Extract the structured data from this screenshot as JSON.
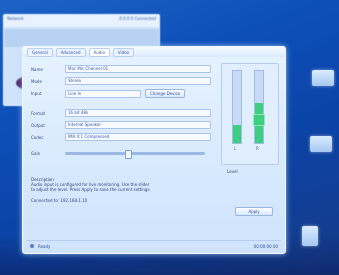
{
  "background_window": {
    "title": "Network",
    "subtitle": "0.0.0.0 Connected"
  },
  "dialog": {
    "tabs": [
      "General",
      "Advanced",
      "Audio",
      "Video"
    ],
    "active_tab": 2,
    "fields": [
      {
        "label": "Name",
        "value": "Mac Mic Channel 01"
      },
      {
        "label": "Mode",
        "value": "Stereo"
      },
      {
        "label": "Input",
        "value": "Line In",
        "button": "Change Device"
      },
      {
        "label": "Format",
        "value": "16 bit 48k"
      },
      {
        "label": "Output",
        "value": "Internal Speaker"
      },
      {
        "label": "Codec",
        "value": "IMA 4:1 Compressed"
      }
    ],
    "slider_label": "Gain",
    "info_caption": "Description",
    "info_lines": [
      "Audio input is configured for live monitoring. Use the slider",
      "to adjust the level. Press Apply to save the current settings.",
      "Connected to: 192.168.1.10"
    ],
    "meter_labels": [
      "L",
      "R"
    ],
    "meter_levels": [
      0.25,
      0.55
    ],
    "level_caption": "Level",
    "apply_label": "Apply",
    "status_left": "Ready",
    "status_right": "00:00:00 00"
  },
  "colors": {
    "desktop": "#0d4fb9",
    "meter_fill": "#3fcf82"
  }
}
